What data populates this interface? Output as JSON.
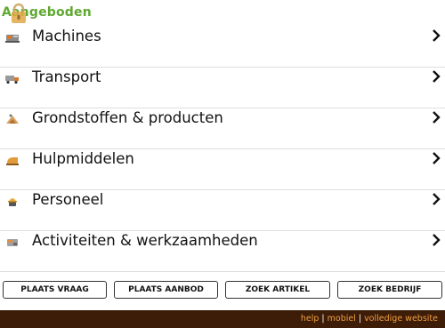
{
  "header": {
    "title": "Aangeboden"
  },
  "categories": [
    {
      "label": "Machines",
      "icon": "machine-icon"
    },
    {
      "label": "Transport",
      "icon": "truck-icon"
    },
    {
      "label": "Grondstoffen & producten",
      "icon": "raw-materials-icon"
    },
    {
      "label": "Hulpmiddelen",
      "icon": "tools-icon"
    },
    {
      "label": "Personeel",
      "icon": "worker-icon"
    },
    {
      "label": "Activiteiten & werkzaamheden",
      "icon": "activities-icon"
    }
  ],
  "buttons": {
    "plaats_vraag": "PLAATS VRAAG",
    "plaats_aanbod": "PLAATS AANBOD",
    "zoek_artikel": "ZOEK ARTIKEL",
    "zoek_bedrijf": "ZOEK BEDRIJF"
  },
  "footer": {
    "help": "help",
    "mobiel": "mobiel",
    "volledige_website": "volledige website",
    "separator": "|"
  },
  "colors": {
    "title_green": "#5fa830",
    "footer_bg": "#3d1c08",
    "footer_link": "#f0a040"
  }
}
